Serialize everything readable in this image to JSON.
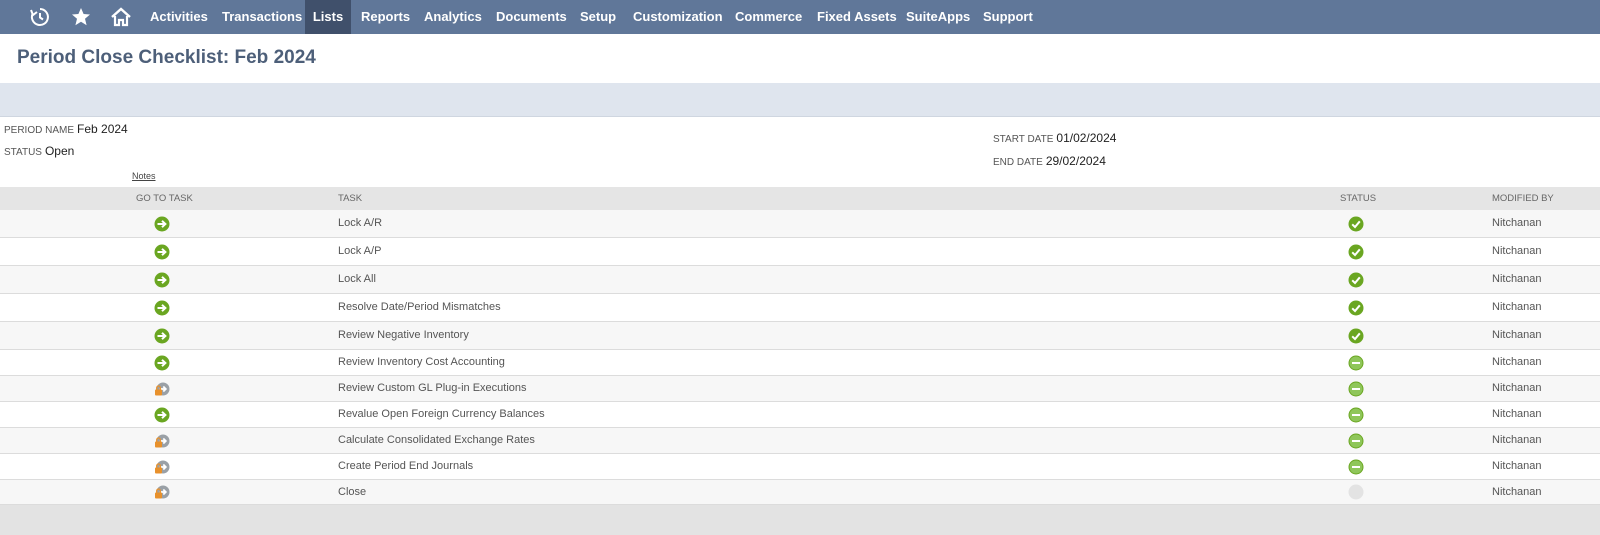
{
  "nav": {
    "icons": [
      "recent-records-icon",
      "star-icon",
      "home-icon"
    ],
    "items": [
      {
        "label": "Activities"
      },
      {
        "label": "Transactions"
      },
      {
        "label": "Lists",
        "active": true
      },
      {
        "label": "Reports"
      },
      {
        "label": "Analytics"
      },
      {
        "label": "Documents"
      },
      {
        "label": "Setup"
      },
      {
        "label": "Customization"
      },
      {
        "label": "Commerce"
      },
      {
        "label": "Fixed Assets"
      },
      {
        "label": "SuiteApps"
      },
      {
        "label": "Support"
      }
    ]
  },
  "page": {
    "title": "Period Close Checklist: Feb 2024"
  },
  "fields": {
    "period_name_label": "PERIOD NAME",
    "period_name_value": "Feb 2024",
    "status_label": "STATUS",
    "status_value": "Open",
    "notes_link": "Notes",
    "start_date_label": "START DATE",
    "start_date_value": "01/02/2024",
    "end_date_label": "END DATE",
    "end_date_value": "29/02/2024"
  },
  "table": {
    "headers": {
      "go_to_task": "GO TO TASK",
      "task": "TASK",
      "status": "STATUS",
      "modified_by": "MODIFIED BY"
    },
    "rows": [
      {
        "goto": "arrow",
        "task": "Lock A/R",
        "status": "complete",
        "modified_by": "Nitchanan"
      },
      {
        "goto": "arrow",
        "task": "Lock A/P",
        "status": "complete",
        "modified_by": "Nitchanan"
      },
      {
        "goto": "arrow",
        "task": "Lock All",
        "status": "complete",
        "modified_by": "Nitchanan"
      },
      {
        "goto": "arrow",
        "task": "Resolve Date/Period Mismatches",
        "status": "complete",
        "modified_by": "Nitchanan"
      },
      {
        "goto": "arrow",
        "task": "Review Negative Inventory",
        "status": "complete",
        "modified_by": "Nitchanan"
      },
      {
        "goto": "arrow",
        "task": "Review Inventory Cost Accounting",
        "status": "in-progress",
        "modified_by": "Nitchanan"
      },
      {
        "goto": "locked",
        "task": "Review Custom GL Plug-in Executions",
        "status": "in-progress",
        "modified_by": "Nitchanan"
      },
      {
        "goto": "arrow",
        "task": "Revalue Open Foreign Currency Balances",
        "status": "in-progress",
        "modified_by": "Nitchanan"
      },
      {
        "goto": "locked",
        "task": "Calculate Consolidated Exchange Rates",
        "status": "in-progress",
        "modified_by": "Nitchanan"
      },
      {
        "goto": "locked",
        "task": "Create Period End Journals",
        "status": "in-progress",
        "modified_by": "Nitchanan"
      },
      {
        "goto": "locked",
        "task": "Close",
        "status": "not-started",
        "modified_by": "Nitchanan"
      }
    ]
  },
  "colors": {
    "nav_bg": "#607799",
    "nav_active": "#40506b",
    "title": "#4d5f79",
    "green": "#6aa621",
    "lock_orange": "#e8912c"
  }
}
